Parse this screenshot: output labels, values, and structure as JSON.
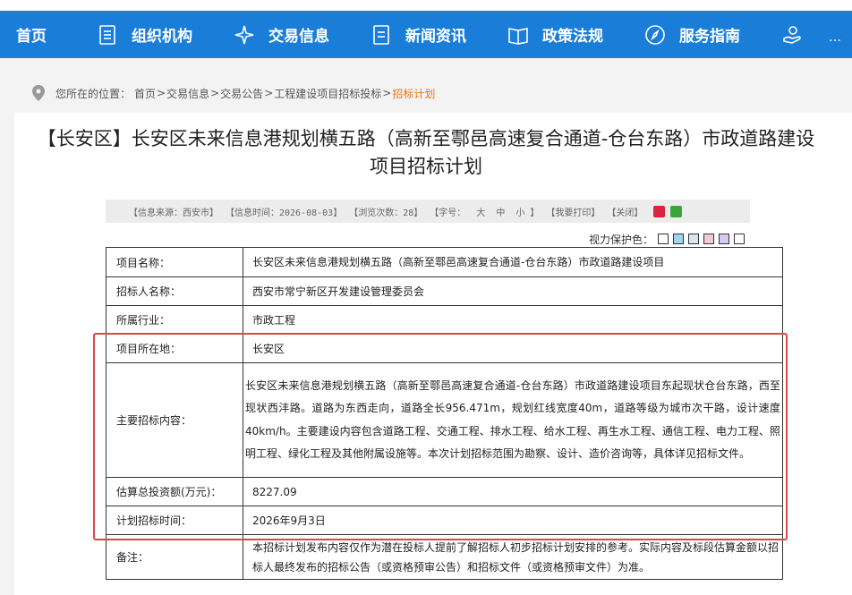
{
  "nav": {
    "items": [
      {
        "label": "首页",
        "icon": ""
      },
      {
        "label": "组织机构",
        "icon": "document-icon"
      },
      {
        "label": "交易信息",
        "icon": "sparkle-icon"
      },
      {
        "label": "新闻资讯",
        "icon": "list-icon"
      },
      {
        "label": "政策法规",
        "icon": "book-icon"
      },
      {
        "label": "服务指南",
        "icon": "compass-icon"
      },
      {
        "label": "",
        "icon": "hand-icon"
      }
    ]
  },
  "breadcrumb": {
    "prefix": "您所在的位置：",
    "items": [
      "首页",
      "交易信息",
      "交易公告",
      "工程建设项目招标投标"
    ],
    "sep": " >",
    "current": "招标计划"
  },
  "article": {
    "title_line1": "【长安区】长安区未来信息港规划横五路（高新至鄠邑高速复合通道-仓台东路）市政道路建设",
    "title_line2": "项目招标计划",
    "meta": {
      "source": "【信息来源：西安市】",
      "time": "【信息时间：2026-08-03】",
      "views": "【浏览次数：28】",
      "font_prefix": "【字号：",
      "font_large": "大",
      "font_medium": "中",
      "font_small": "小",
      "font_suffix": "】",
      "print": "【我要打印】",
      "close": "【关闭】"
    },
    "protect_label": "视力保护色：",
    "protect_colors": [
      "#ffffff",
      "#9fd3f2",
      "#d9e6f2",
      "#f3c9da",
      "#d9c8f2",
      "#ffffff"
    ]
  },
  "table": {
    "rows": [
      {
        "key": "项目名称：",
        "value": "长安区未来信息港规划横五路（高新至鄠邑高速复合通道-仓台东路）市政道路建设项目"
      },
      {
        "key": "招标人名称：",
        "value": "西安市常宁新区开发建设管理委员会"
      },
      {
        "key": "所属行业：",
        "value": "市政工程"
      },
      {
        "key": "项目所在地：",
        "value": "长安区"
      },
      {
        "key": "主要招标内容：",
        "value": "长安区未来信息港规划横五路（高新至鄠邑高速复合通道-仓台东路）市政道路建设项目东起现状仓台东路，西至现状西沣路。道路为东西走向，道路全长956.471m，规划红线宽度40m，道路等级为城市次干路，设计速度40km/h。主要建设内容包含道路工程、交通工程、排水工程、给水工程、再生水工程、通信工程、电力工程、照明工程、绿化工程及其他附属设施等。本次计划招标范围为勘察、设计、造价咨询等，具体详见招标文件。"
      },
      {
        "key": "估算总投资额(万元)：",
        "value": "8227.09"
      },
      {
        "key": "计划招标时间：",
        "value": "2026年9月3日"
      },
      {
        "key": "备注：",
        "value": "本招标计划发布内容仅作为潜在投标人提前了解招标人初步招标计划安排的参考。实际内容及标段估算金额以招标人最终发布的招标公告（或资格预审公告）和招标文件（或资格预审文件）为准。"
      }
    ]
  },
  "colors": {
    "nav_bg": "#1a7ed9",
    "current_crumb": "#e8741b",
    "highlight_box": "#e0454a"
  }
}
